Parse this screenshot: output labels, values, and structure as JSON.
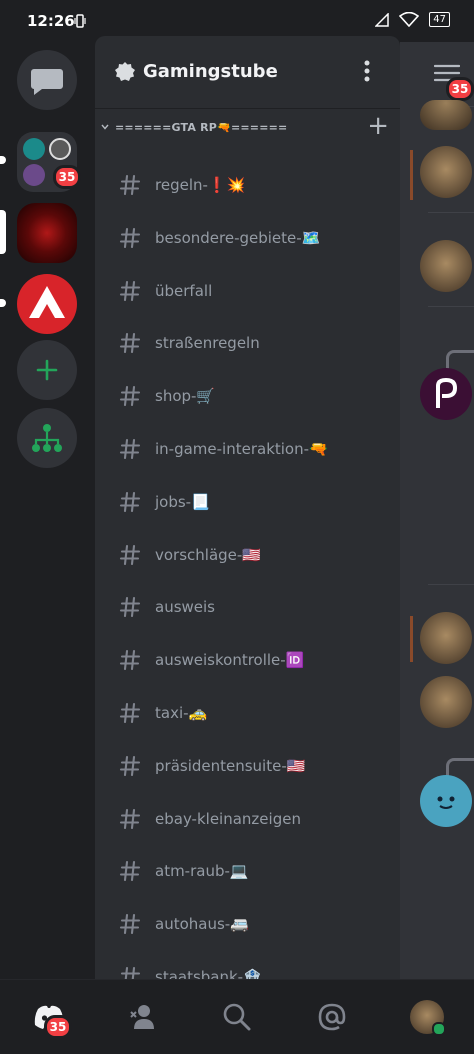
{
  "status": {
    "time": "12:26",
    "battery": "47"
  },
  "rail": {
    "folder_badge": "35"
  },
  "guild": {
    "name": "Gamingstube"
  },
  "category": {
    "label": "======GTA RP🔫======"
  },
  "channels": [
    "regeln-❗💥",
    "besondere-gebiete-🗺️",
    "überfall",
    "straßenregeln",
    "shop-🛒",
    "in-game-interaktion-🔫",
    "jobs-📃",
    "vorschläge-🇺🇸",
    "ausweis",
    "ausweiskontrolle-🆔",
    "taxi-🚕",
    "präsidentensuite-🇺🇸",
    "ebay-kleinanzeigen",
    "atm-raub-💻",
    "autohaus-🚐",
    "staatsbank-🏦"
  ],
  "peek": {
    "badge": "35"
  },
  "bottom_nav": {
    "home_badge": "35"
  },
  "colors": {
    "accent_green": "#23a55a",
    "badge_red": "#f23f43",
    "panel": "#2b2d31"
  }
}
